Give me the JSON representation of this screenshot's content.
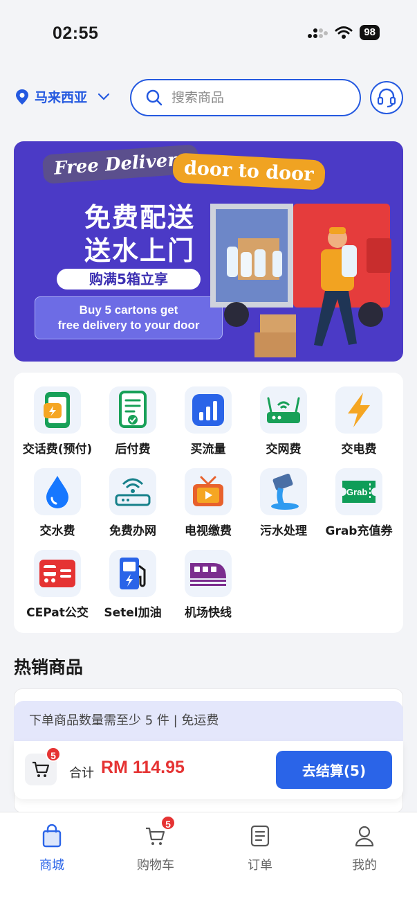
{
  "status_bar": {
    "time": "02:55",
    "battery": "98"
  },
  "header": {
    "location": "马来西亚",
    "search_placeholder": "搜索商品"
  },
  "banner": {
    "tag_free": "Free Delivery",
    "tag_door": "door to door",
    "headline_1": "免费配送",
    "headline_2": "送水上门",
    "pill": "购满5箱立享",
    "note_line1": "Buy 5 cartons get",
    "note_line2": "free delivery to your door",
    "bg_color": "#4b3ac6"
  },
  "services": [
    {
      "label": "交话费(预付)",
      "icon": "prepaid-phone-icon"
    },
    {
      "label": "后付费",
      "icon": "postpaid-bill-icon"
    },
    {
      "label": "买流量",
      "icon": "data-bars-icon"
    },
    {
      "label": "交网费",
      "icon": "router-icon"
    },
    {
      "label": "交电费",
      "icon": "lightning-icon"
    },
    {
      "label": "交水费",
      "icon": "water-drop-icon"
    },
    {
      "label": "免费办网",
      "icon": "wifi-router-icon"
    },
    {
      "label": "电视缴费",
      "icon": "tv-icon"
    },
    {
      "label": "污水处理",
      "icon": "sewage-icon"
    },
    {
      "label": "Grab充值券",
      "icon": "grab-voucher-icon"
    },
    {
      "label": "CEPat公交",
      "icon": "bus-icon"
    },
    {
      "label": "Setel加油",
      "icon": "fuel-pump-icon"
    },
    {
      "label": "机场快线",
      "icon": "train-icon"
    }
  ],
  "hot_section_title": "热销商品",
  "checkout": {
    "notice": "下单商品数量需至少 5 件 | 免运费",
    "cart_count": "5",
    "total_label": "合计",
    "total_amount": "RM 114.95",
    "checkout_label": "去结算(5)"
  },
  "tabbar": {
    "tabs": [
      {
        "label": "商城",
        "icon": "shop-bag-icon",
        "active": true
      },
      {
        "label": "购物车",
        "icon": "cart-icon",
        "badge": "5"
      },
      {
        "label": "订单",
        "icon": "order-list-icon"
      },
      {
        "label": "我的",
        "icon": "profile-icon"
      }
    ]
  },
  "colors": {
    "primary": "#2459e0",
    "accent_red": "#e53333"
  }
}
